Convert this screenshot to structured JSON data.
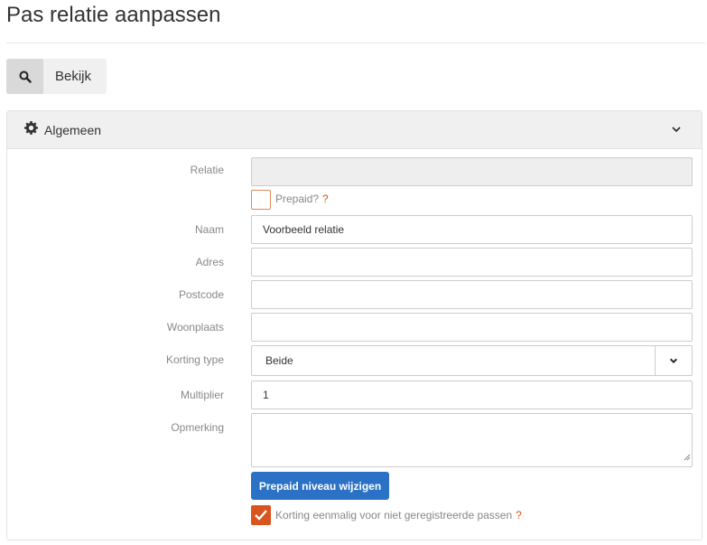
{
  "page": {
    "title": "Pas relatie aanpassen"
  },
  "toolbar": {
    "view_label": "Bekijk"
  },
  "panel": {
    "title": "Algemeen"
  },
  "form": {
    "relatie": {
      "label": "Relatie",
      "value": ""
    },
    "prepaid": {
      "label": "Prepaid?",
      "help": "?",
      "checked": false
    },
    "naam": {
      "label": "Naam",
      "value": "Voorbeeld relatie"
    },
    "adres": {
      "label": "Adres",
      "value": ""
    },
    "postcode": {
      "label": "Postcode",
      "value": ""
    },
    "woonplaats": {
      "label": "Woonplaats",
      "value": ""
    },
    "korting_type": {
      "label": "Korting type",
      "value": "Beide"
    },
    "multiplier": {
      "label": "Multiplier",
      "value": "1"
    },
    "opmerking": {
      "label": "Opmerking",
      "value": ""
    },
    "prepaid_button": "Prepaid niveau wijzigen",
    "korting_eenmalig": {
      "label": "Korting eenmalig voor niet geregistreerde passen",
      "help": "?",
      "checked": true
    }
  },
  "colors": {
    "accent": "#d9541e",
    "primary": "#2b72c6"
  },
  "icons": {
    "view": "search-icon",
    "panel": "gear-icon",
    "collapse": "chevron-down-icon"
  }
}
